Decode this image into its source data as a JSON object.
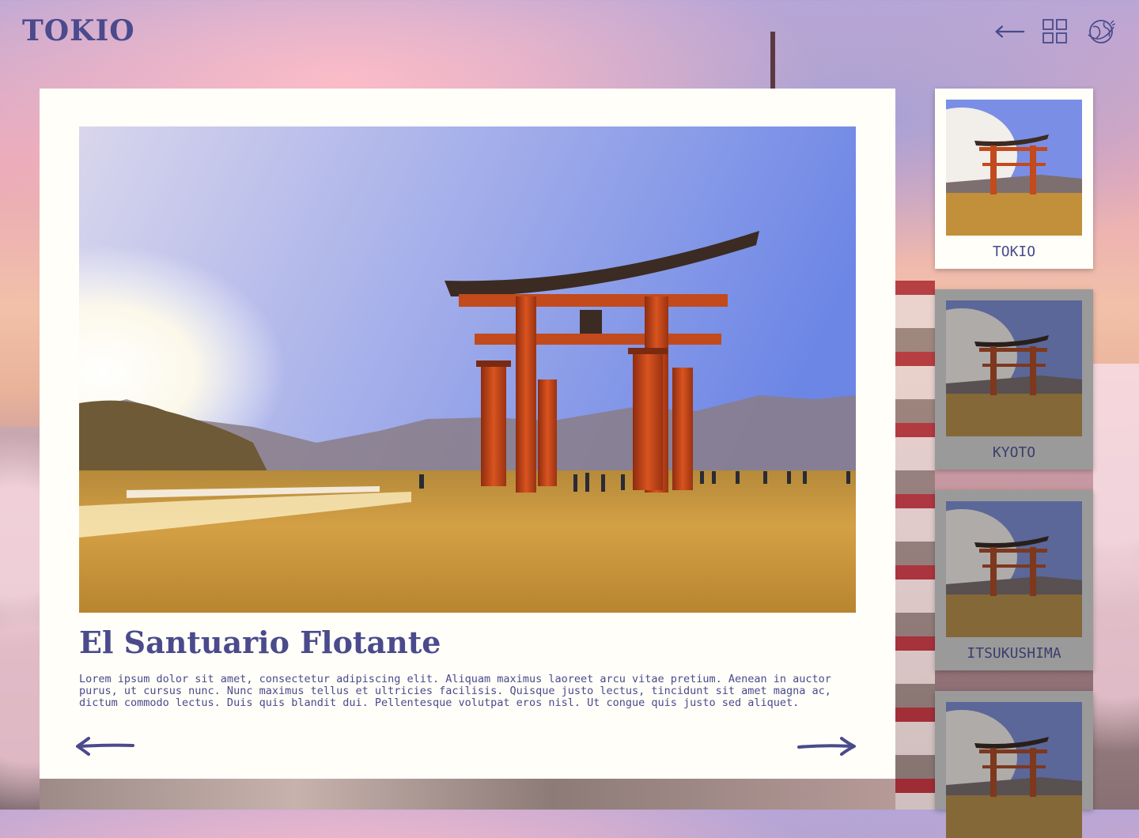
{
  "header": {
    "logo": "TOKIO",
    "icons": [
      "back-arrow-icon",
      "grid-icon",
      "globe-icon"
    ]
  },
  "main": {
    "title": "El Santuario Flotante",
    "description": "Lorem ipsum dolor sit amet, consectetur adipiscing elit. Aliquam maximus laoreet arcu vitae pretium. Aenean in auctor purus, ut cursus nunc. Nunc maximus tellus et ultricies facilisis. Quisque justo lectus, tincidunt sit amet magna ac, dictum commodo lectus. Duis quis blandit dui. Pellentesque volutpat eros nisl. Ut congue quis justo sed aliquet."
  },
  "thumbnails": [
    {
      "label": "TOKIO",
      "active": true
    },
    {
      "label": "KYOTO",
      "active": false
    },
    {
      "label": "ITSUKUSHIMA",
      "active": false
    },
    {
      "label": "",
      "active": false
    }
  ],
  "colors": {
    "accent": "#4a4a8c",
    "card": "#fffef9",
    "torii": "#c24a1c"
  }
}
